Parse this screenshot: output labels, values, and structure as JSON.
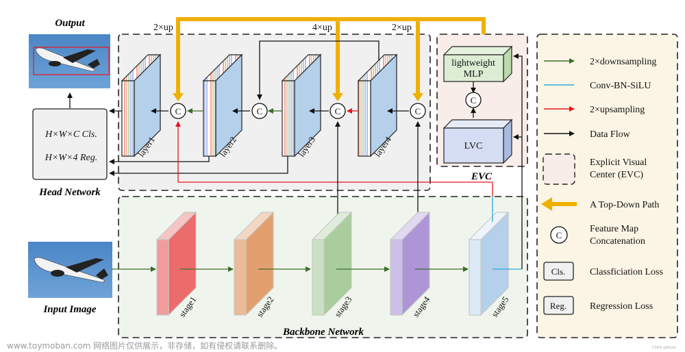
{
  "titles": {
    "output": "Output",
    "head_network": "Head Network",
    "input_image": "Input Image",
    "backbone_network": "Backbone Network",
    "evc": "EVC"
  },
  "head_box": {
    "cls_line": "H×W×C  Cls.",
    "reg_line": "H×W×4  Reg."
  },
  "upsample_labels": [
    "2×up",
    "4×up",
    "2×up"
  ],
  "concat_symbol": "C",
  "layers": [
    "layer1",
    "layer2",
    "layer3",
    "layer4"
  ],
  "stages": [
    "stage1",
    "stage2",
    "stage3",
    "stage4",
    "stage5"
  ],
  "evc_blocks": {
    "mlp_line1": "lightweight",
    "mlp_line2": "MLP",
    "lvc": "LVC"
  },
  "legend": {
    "items": [
      {
        "label": "2×downsampling",
        "kind": "arrow",
        "color": "#3d6b2a"
      },
      {
        "label": "Conv-BN-SiLU",
        "kind": "line",
        "color": "#29a8e0"
      },
      {
        "label": "2×upsampling",
        "kind": "arrow",
        "color": "#e8141b"
      },
      {
        "label": "Data Flow",
        "kind": "arrow",
        "color": "#111111"
      }
    ],
    "evc_line1": "Explicit Visual",
    "evc_line2": "Center (EVC)",
    "topdown": "A Top-Down Path",
    "concat_line1": "Feature Map",
    "concat_line2": "Concatenation",
    "cls_badge": "Cls.",
    "cls_text": "Classficiation Loss",
    "reg_badge": "Reg.",
    "reg_text": "Regression Loss"
  },
  "colors": {
    "topdown": "#f0b000",
    "downsample": "#3d6b2a",
    "upsample": "#e8141b",
    "conv": "#29a8e0",
    "head_bg": "#f0f0f0",
    "backbone_bg": "#eff5ec",
    "evc_bg": "#f8ede8",
    "legend_bg": "#fcf5e5"
  },
  "watermark": "www.toymoban.com 网络图片仅供展示，非存储，如有侵权请联系删除。",
  "corner_mark": "CSDN @Eddie"
}
